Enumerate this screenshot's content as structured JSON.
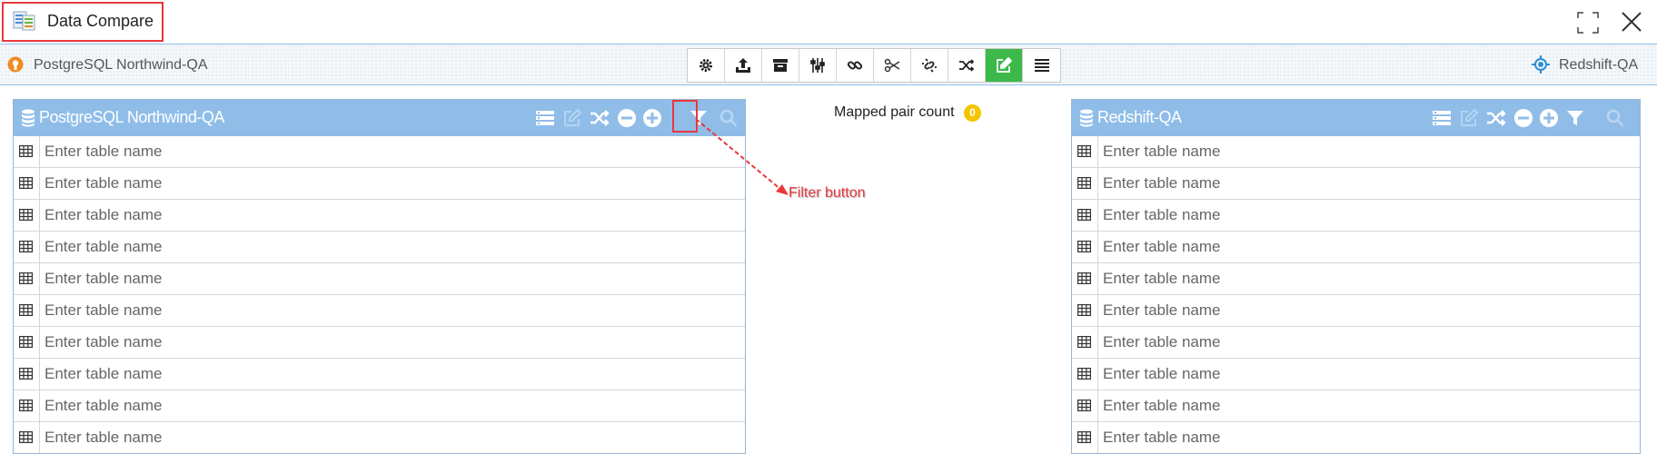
{
  "window": {
    "title": "Data Compare"
  },
  "connections": {
    "left": {
      "label": "PostgreSQL Northwind-QA"
    },
    "right": {
      "label": "Redshift-QA"
    }
  },
  "toolbar": {
    "buttons": [
      {
        "name": "settings-button",
        "icon": "gear-icon"
      },
      {
        "name": "upload-button",
        "icon": "upload-icon"
      },
      {
        "name": "archive-button",
        "icon": "archive-icon"
      },
      {
        "name": "sliders-button",
        "icon": "sliders-icon"
      },
      {
        "name": "link-button",
        "icon": "link-icon"
      },
      {
        "name": "cut-button",
        "icon": "scissors-icon"
      },
      {
        "name": "unlink-button",
        "icon": "unlink-icon"
      },
      {
        "name": "shuffle-button",
        "icon": "shuffle-icon"
      },
      {
        "name": "edit-button",
        "icon": "edit-icon",
        "active": true
      },
      {
        "name": "list-button",
        "icon": "list-icon"
      }
    ],
    "active_color": "#3cb94a"
  },
  "mapped": {
    "label": "Mapped pair count",
    "count": "0",
    "badge_color": "#f5c400"
  },
  "left_panel": {
    "title": "PostgreSQL Northwind-QA",
    "row_placeholder": "Enter table name",
    "row_count": 10
  },
  "right_panel": {
    "title": "Redshift-QA",
    "row_placeholder": "Enter table name",
    "row_count": 10
  },
  "annotation": {
    "text": "Filter button",
    "color": "#e8383d"
  },
  "colors": {
    "panel_header": "#8fbde8",
    "border": "#8fc0e8"
  }
}
